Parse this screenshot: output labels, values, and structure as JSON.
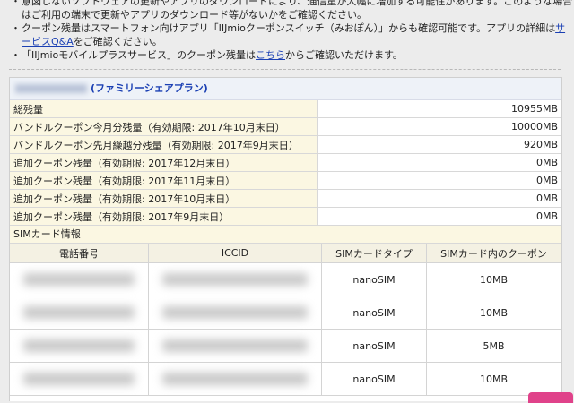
{
  "notice": {
    "items": [
      {
        "bullet": "・",
        "text": "意図しないソフトウェアの更新やアプリのダウンロードにより、通信量が大幅に増加する可能性があります。このような場合はご利用の端末で更新やアプリのダウンロード等がないかをご確認ください。"
      },
      {
        "bullet": "・",
        "pre": "クーポン残量はスマートフォン向けアプリ「IIJmioクーポンスイッチ（みおぽん）」からも確認可能です。アプリの詳細は",
        "link": "サービスQ&A",
        "post": "をご確認ください。"
      },
      {
        "bullet": "・",
        "pre": "「IIJmioモバイルプラスサービス」のクーポン残量は",
        "link": "こちら",
        "post": "からご確認いただけます。"
      }
    ]
  },
  "plan": {
    "title": "(ファミリーシェアプラン)"
  },
  "remaining": [
    {
      "label": "総残量",
      "value": "10955MB"
    },
    {
      "label": "バンドルクーポン今月分残量（有効期限: 2017年10月末日）",
      "value": "10000MB"
    },
    {
      "label": "バンドルクーポン先月繰越分残量（有効期限: 2017年9月末日）",
      "value": "920MB"
    },
    {
      "label": "追加クーポン残量（有効期限: 2017年12月末日）",
      "value": "0MB"
    },
    {
      "label": "追加クーポン残量（有効期限: 2017年11月末日）",
      "value": "0MB"
    },
    {
      "label": "追加クーポン残量（有効期限: 2017年10月末日）",
      "value": "0MB"
    },
    {
      "label": "追加クーポン残量（有効期限: 2017年9月末日）",
      "value": "0MB"
    }
  ],
  "sim": {
    "section_label": "SIMカード情報",
    "headers": [
      "電話番号",
      "ICCID",
      "SIMカードタイプ",
      "SIMカード内のクーポン"
    ],
    "rows": [
      {
        "type": "nanoSIM",
        "coupon": "10MB"
      },
      {
        "type": "nanoSIM",
        "coupon": "10MB"
      },
      {
        "type": "nanoSIM",
        "coupon": "5MB"
      },
      {
        "type": "nanoSIM",
        "coupon": "10MB"
      }
    ]
  }
}
